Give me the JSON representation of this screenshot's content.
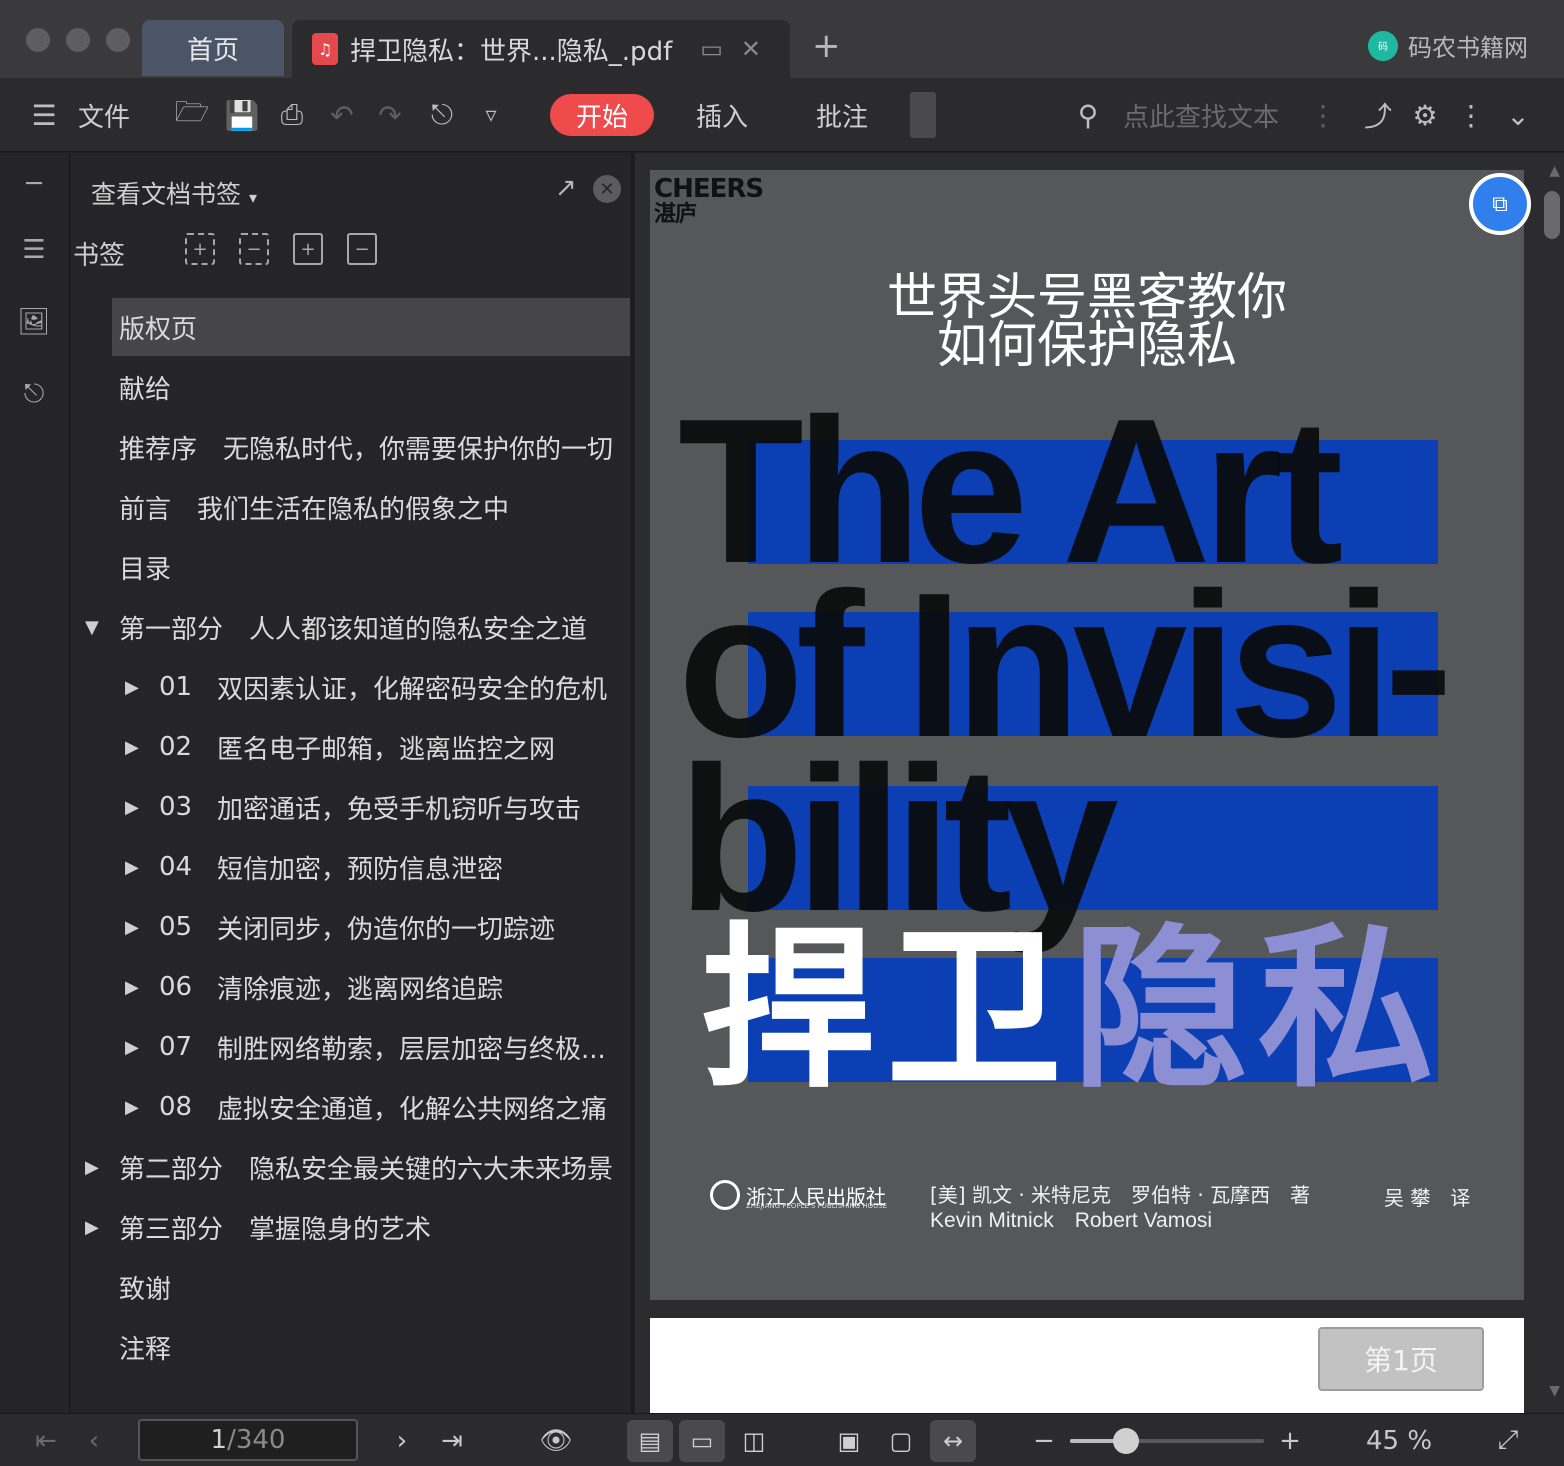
{
  "titlebar": {
    "tabs": [
      {
        "label": "首页"
      },
      {
        "label": "捍卫隐私：世界...隐私_.pdf"
      }
    ],
    "add_tab": "+",
    "brand": "码农书籍网"
  },
  "toolbar": {
    "file_label": "文件",
    "start_label": "开始",
    "insert_label": "插入",
    "annotate_label": "批注",
    "search_placeholder": "点此查找文本"
  },
  "panel": {
    "title": "查看文档书签",
    "bookmark_label": "书签",
    "items": [
      {
        "num": "",
        "text": "版权页",
        "level": 0,
        "arrow": "",
        "selected": true
      },
      {
        "num": "",
        "text": "献给",
        "level": 0,
        "arrow": ""
      },
      {
        "num": "",
        "text": "推荐序　无隐私时代，你需要保护你的一切",
        "level": 0,
        "arrow": ""
      },
      {
        "num": "",
        "text": "前言　我们生活在隐私的假象之中",
        "level": 0,
        "arrow": ""
      },
      {
        "num": "",
        "text": "目录",
        "level": 0,
        "arrow": ""
      },
      {
        "num": "",
        "text": "第一部分　人人都该知道的隐私安全之道",
        "level": 0,
        "arrow": "▼"
      },
      {
        "num": "01",
        "text": "双因素认证，化解密码安全的危机",
        "level": 1,
        "arrow": "▶"
      },
      {
        "num": "02",
        "text": "匿名电子邮箱，逃离监控之网",
        "level": 1,
        "arrow": "▶"
      },
      {
        "num": "03",
        "text": "加密通话，免受手机窃听与攻击",
        "level": 1,
        "arrow": "▶"
      },
      {
        "num": "04",
        "text": "短信加密，预防信息泄密",
        "level": 1,
        "arrow": "▶"
      },
      {
        "num": "05",
        "text": "关闭同步，伪造你的一切踪迹",
        "level": 1,
        "arrow": "▶"
      },
      {
        "num": "06",
        "text": "清除痕迹，逃离网络追踪",
        "level": 1,
        "arrow": "▶"
      },
      {
        "num": "07",
        "text": "制胜网络勒索，层层加密与终极...",
        "level": 1,
        "arrow": "▶"
      },
      {
        "num": "08",
        "text": "虚拟安全通道，化解公共网络之痛",
        "level": 1,
        "arrow": "▶"
      },
      {
        "num": "",
        "text": "第二部分　隐私安全最关键的六大未来场景",
        "level": 0,
        "arrow": "▶"
      },
      {
        "num": "",
        "text": "第三部分　掌握隐身的艺术",
        "level": 0,
        "arrow": "▶"
      },
      {
        "num": "",
        "text": "致谢",
        "level": 0,
        "arrow": ""
      },
      {
        "num": "",
        "text": "注释",
        "level": 0,
        "arrow": ""
      }
    ]
  },
  "cover": {
    "imprint_en": "CHEERS",
    "imprint_cn": "湛庐",
    "subtitle_line1": "世界头号黑客教你",
    "subtitle_line2": "如何保护隐私",
    "title_en_line1": "The Art",
    "title_en_line2": "of Invisi-",
    "title_en_line3": "bility",
    "title_cn_part1": "捍卫",
    "title_cn_part2": "隐私",
    "publisher": "浙江人民出版社",
    "publisher_en": "ZHEJIANG PEOPLE'S PUBLISHING HOUSE",
    "authors_cn": "[美] 凯文 · 米特尼克　罗伯特 · 瓦摩西　著",
    "authors_en": "Kevin Mitnick　Robert Vamosi",
    "translator": "吴 攀　译"
  },
  "docview": {
    "page_badge": "第1页"
  },
  "statusbar": {
    "current_page": "1",
    "page_separator": "/",
    "total_pages": "340",
    "zoom_text": "45 %",
    "zoom_fraction": 0.29
  },
  "colors": {
    "accent_red": "#f04b4c",
    "cover_blue": "#0b3fb3",
    "cover_bg": "#555759",
    "float_button": "#2f80ed"
  }
}
